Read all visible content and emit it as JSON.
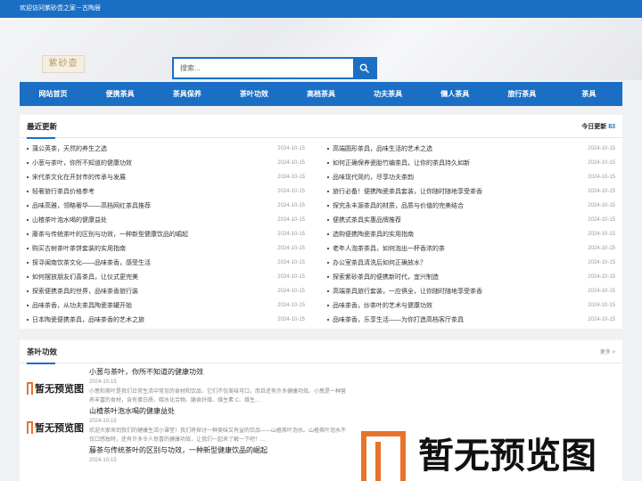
{
  "topbar": {
    "welcome": "欢迎访问紫砂壶之家－古陶居"
  },
  "logo": {
    "text": "紫砂壶"
  },
  "search": {
    "placeholder": "搜索..."
  },
  "nav": [
    "网站首页",
    "便携茶具",
    "茶具保养",
    "茶叶功效",
    "高档茶具",
    "功夫茶具",
    "懒人茶具",
    "旅行茶具",
    "茶具"
  ],
  "latest": {
    "title": "最近更新",
    "today_label": "今日更新",
    "today_count": "83",
    "left": [
      {
        "title": "蒲公英茶，天然的养生之选",
        "date": "2024-10-15"
      },
      {
        "title": "小葱与茶叶，你所不知道的健康功效",
        "date": "2024-10-15"
      },
      {
        "title": "宋代茶文化在开封市的传承与发展",
        "date": "2024-10-15"
      },
      {
        "title": "轻奢旅行茶具价格参考",
        "date": "2024-10-15"
      },
      {
        "title": "品味高雅，领略奢华——高档网红茶具推荐",
        "date": "2024-10-15"
      },
      {
        "title": "山楂茶叶泡水喝的健康益处",
        "date": "2024-10-15"
      },
      {
        "title": "藤茶与传统茶叶的区别与功效，一种新型健康饮品的崛起",
        "date": "2024-10-15"
      },
      {
        "title": "购买古树茶叶茶饼套装的实用指南",
        "date": "2024-10-15"
      },
      {
        "title": "探寻闽南饮茶文化——品味茶香，感受生活",
        "date": "2024-10-15"
      },
      {
        "title": "如何摆放朋友们喜茶具，让仪式更完美",
        "date": "2024-10-15"
      },
      {
        "title": "探索便携茶具的世界，品味茶香旅行装",
        "date": "2024-10-15"
      },
      {
        "title": "品味茶香，从功夫茶具陶瓷茶罐开始",
        "date": "2024-10-15"
      },
      {
        "title": "日本陶瓷便携茶具，品味茶香的艺术之旅",
        "date": "2024-10-15"
      }
    ],
    "right": [
      {
        "title": "高端圆形茶具，品味生活的艺术之选",
        "date": "2024-10-15"
      },
      {
        "title": "如何正确保养瓷胎竹编茶具，让你的茶具持久如新",
        "date": "2024-10-15"
      },
      {
        "title": "品味现代简约，尽享功夫茶韵",
        "date": "2024-10-15"
      },
      {
        "title": "旅行必备！便携陶瓷茶具套装，让你随时随地享受茶香",
        "date": "2024-10-15"
      },
      {
        "title": "探究永丰源茶具的材质，品质与价值的完美结合",
        "date": "2024-10-15"
      },
      {
        "title": "便携式茶具实惠品牌推荐",
        "date": "2024-10-15"
      },
      {
        "title": "选购便携陶瓷茶具的实用指南",
        "date": "2024-10-15"
      },
      {
        "title": "老年人泡茶茶具，如何泡出一杯香浓的茶",
        "date": "2024-10-15"
      },
      {
        "title": "办公室茶具清洗后如何正确放水？",
        "date": "2024-10-15"
      },
      {
        "title": "探索紫砂茶具的便携新时代，宜兴制造",
        "date": "2024-10-15"
      },
      {
        "title": "高端茶具旅行套装，一应俱全，让你随时随地享受茶香",
        "date": "2024-10-15"
      },
      {
        "title": "品味茶香，炒茶叶的艺术与健康功效",
        "date": "2024-10-15"
      },
      {
        "title": "品味茶香，乐享生活——为你打造高档客厅茶具",
        "date": "2024-10-15"
      }
    ]
  },
  "tea": {
    "title": "茶叶功效",
    "more": "更多 >",
    "placeholder_text": "暂无预览图",
    "articles": [
      {
        "title": "小葱与茶叶，你所不知道的健康功效",
        "date": "2024-10-15",
        "desc": "小葱和茶叶是我们日常生活中常见的食材和饮品，它们不仅美味可口，而且还有许多健康功效。小葱是一种营养丰富的食材，含有蛋白质、碳水化合物、膳食纤维、维生素 C、维生..."
      },
      {
        "title": "山楂茶叶泡水喝的健康益处",
        "date": "2024-10-15",
        "desc": "欢迎大家来到我们的健康生活小课堂！我们将探讨一种美味又有益的饮品——山楂茶叶泡水。山楂茶叶泡水不仅口感独特，还有许多令人惊喜的健康功效，让我们一起来了解一下吧！..."
      },
      {
        "title": "藤茶与传统茶叶的区别与功效，一种新型健康饮品的崛起",
        "date": "2024-10-15",
        "desc": ""
      }
    ]
  },
  "colors": {
    "primary": "#1a6fc4",
    "accent": "#e8732a"
  }
}
